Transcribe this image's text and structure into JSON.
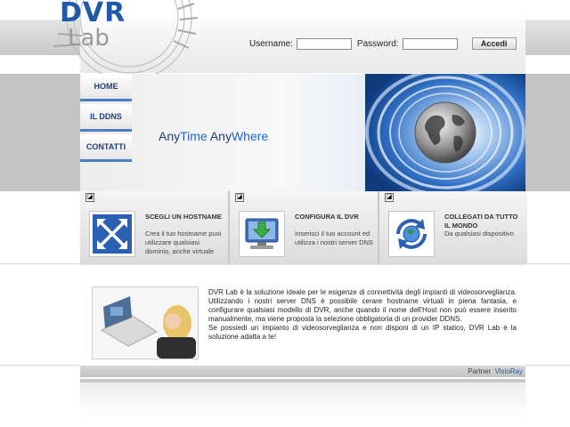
{
  "logo": {
    "part1": "DVR",
    "part2": "Lab"
  },
  "login": {
    "username_label": "Username:",
    "username_value": "",
    "password_label": "Password:",
    "password_value": "",
    "submit_label": "Accedi"
  },
  "nav": {
    "items": [
      {
        "label": "HOME"
      },
      {
        "label": "IL DDNS"
      },
      {
        "label": "CONTATTI"
      }
    ]
  },
  "hero": {
    "tag_part1": "Any",
    "tag_part2": "Time ",
    "tag_part3": "Any",
    "tag_part4": "Where"
  },
  "features": [
    {
      "title": "SCEGLI UN HOSTNAME",
      "text": "Crea il tuo hostname puoi utilizzare qualsiasi dominio, anche virtuale",
      "icon": "arrows-expand-icon"
    },
    {
      "title": "CONFIGURA IL DVR",
      "text": "Inserisci il tuo account ed utilizza i nostri server DNS",
      "icon": "computer-download-icon"
    },
    {
      "title": "COLLEGATI DA TUTTO IL MONDO",
      "text": "Da qualsiasi dispositivo",
      "icon": "globe-refresh-icon"
    }
  ],
  "content": {
    "paragraph1": "DVR Lab è la soluzione ideale per le esigenze di connettività degli impianti di videosorveglianza. Utilizzando i nostri server DNS è possibile cerare hostname virtuali in piena fantasia, e configurare qualsiasi modello di DVR, anche quando il nome dell'Host non può essere inserito manualmente, ma viene proposta la selezione obbligatoria di un provider DDNS.",
    "paragraph2": "Se possiedi un impianto di videosorveglianza e non disponi di un IP statico, DVR Lab è la soluzione adatta a te!"
  },
  "footer": {
    "partner_label": "Partner",
    "partner_link": "VisioRay"
  },
  "colors": {
    "accent": "#1e5aa8",
    "nav_text": "#1d3f7a",
    "link": "#1d5fb5"
  }
}
